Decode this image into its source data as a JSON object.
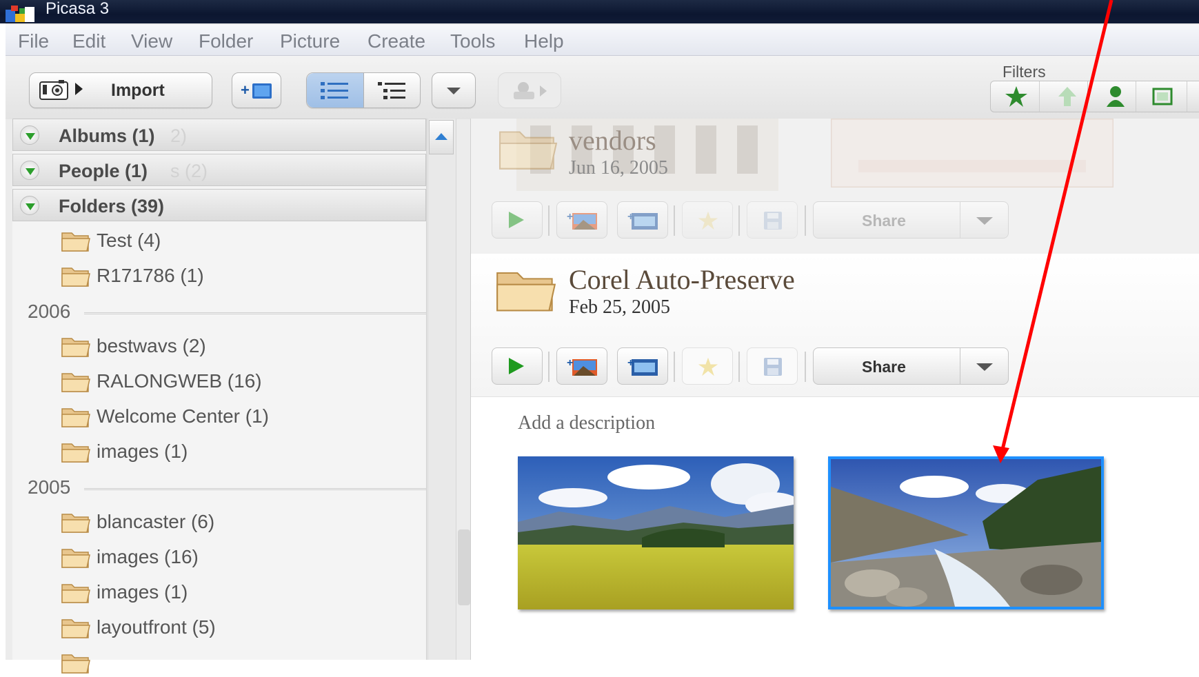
{
  "window": {
    "title": "Picasa 3"
  },
  "menu": [
    "File",
    "Edit",
    "View",
    "Folder",
    "Picture",
    "Create",
    "Tools",
    "Help"
  ],
  "toolbar": {
    "import_label": "Import",
    "filters_label": "Filters"
  },
  "sidebar": {
    "sections": [
      {
        "label": "Albums (1)",
        "ghost": "2)"
      },
      {
        "label": "People (1)",
        "ghost": "s (2)"
      },
      {
        "label": "Folders (39)",
        "ghost": ""
      }
    ],
    "folders_top": [
      "Test (4)",
      "R171786 (1)"
    ],
    "groups": [
      {
        "year": "2006",
        "folders": [
          "bestwavs (2)",
          "RALONGWEB (16)",
          "Welcome Center (1)",
          "images (1)"
        ]
      },
      {
        "year": "2005",
        "folders": [
          "blancaster (6)",
          "images (16)",
          "images (1)",
          "layoutfront (5)"
        ]
      }
    ]
  },
  "albums": [
    {
      "title": "vendors",
      "date": "Jun 16, 2005",
      "share_label": "Share"
    },
    {
      "title": "Corel Auto-Preserve",
      "date": "Feb 25, 2005",
      "share_label": "Share",
      "description_placeholder": "Add a description"
    }
  ],
  "colors": {
    "accent_selection": "#1e90ff",
    "arrow": "#ff0000",
    "play_green": "#2c9e2c"
  }
}
